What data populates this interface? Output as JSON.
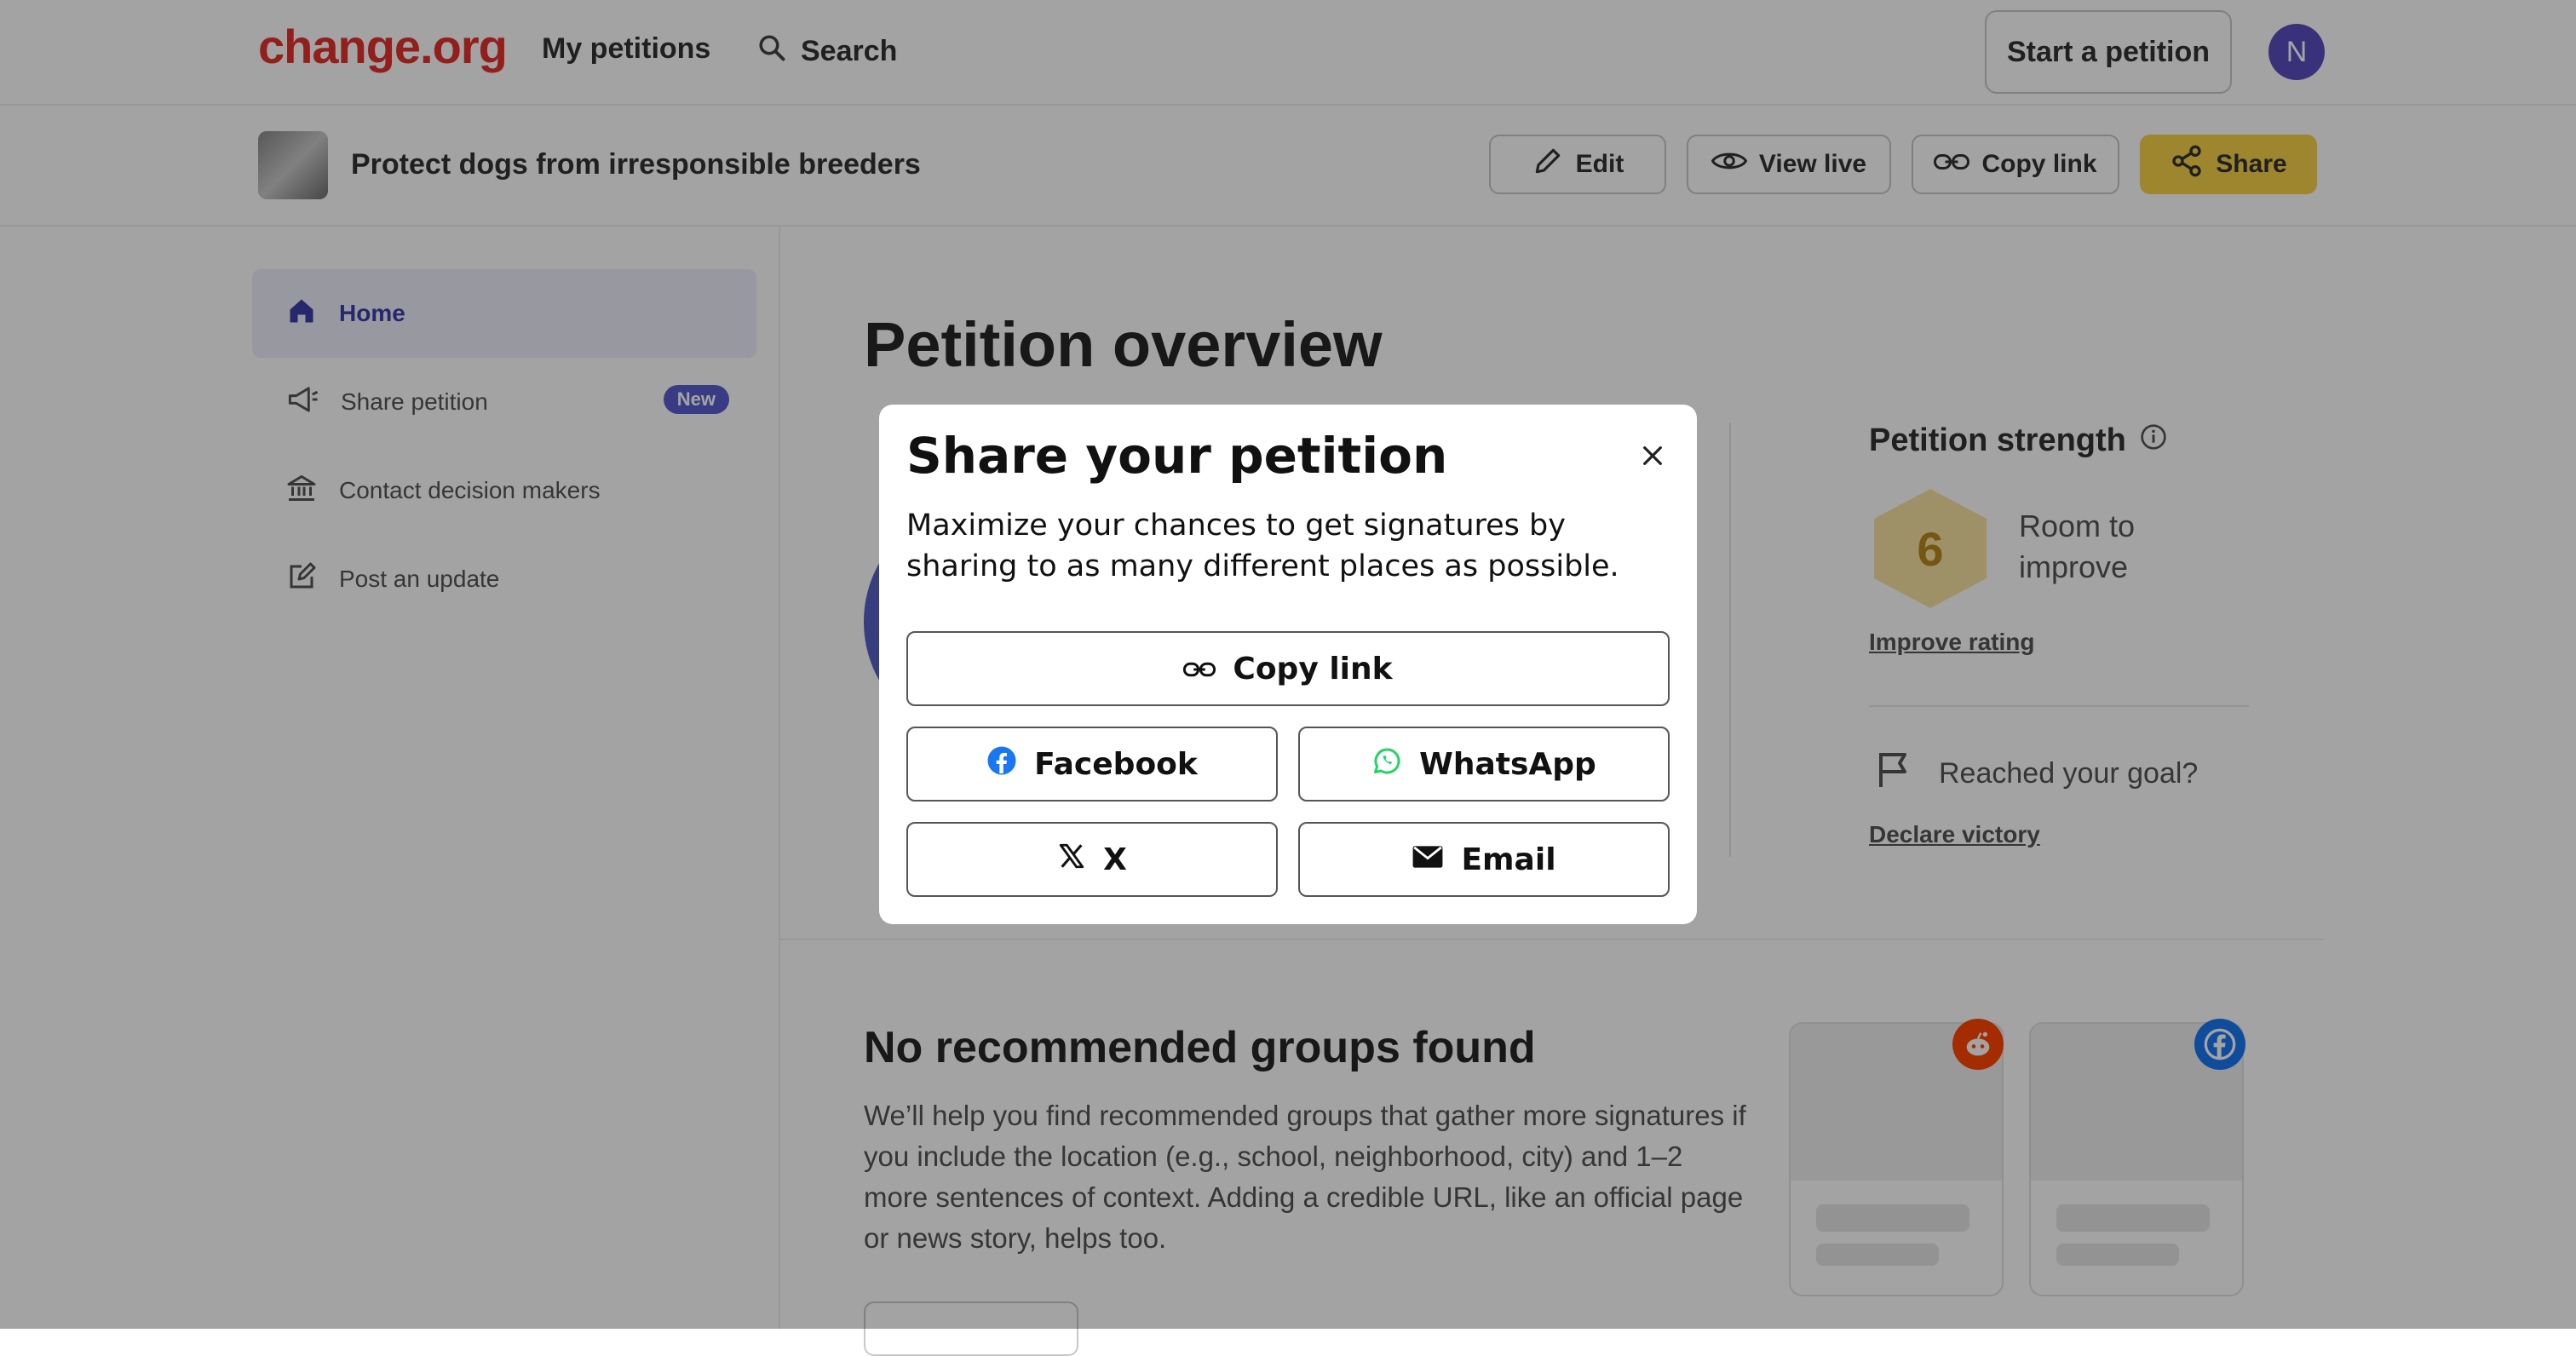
{
  "nav": {
    "logo": "change.org",
    "my_petitions": "My petitions",
    "search": "Search",
    "start_petition": "Start a petition",
    "avatar_initial": "N"
  },
  "petition": {
    "title": "Protect dogs from irresponsible breeders",
    "buttons": {
      "edit": "Edit",
      "view_live": "View live",
      "copy_link": "Copy link",
      "share": "Share"
    }
  },
  "sidebar": {
    "items": [
      {
        "label": "Home",
        "icon": "home-icon",
        "active": true
      },
      {
        "label": "Share petition",
        "icon": "megaphone-icon",
        "badge": "New"
      },
      {
        "label": "Contact decision makers",
        "icon": "building-icon"
      },
      {
        "label": "Post an update",
        "icon": "edit-square-icon"
      }
    ]
  },
  "main": {
    "title": "Petition overview",
    "strength": {
      "title": "Petition strength",
      "score": "6",
      "rating_text": "Room to improve",
      "improve_link": "Improve rating"
    },
    "goal": {
      "text": "Reached your goal?",
      "link": "Declare victory"
    },
    "groups": {
      "title": "No recommended groups found",
      "text": "We’ll help you find recommended groups that gather more signatures if you include the location (e.g., school, neighborhood, city) and 1–2 more sentences of context. Adding a credible URL, like an official page or news story, helps too."
    }
  },
  "modal": {
    "title": "Share your petition",
    "description": "Maximize your chances to get signatures by sharing to as many different places as possible.",
    "buttons": {
      "copy_link": "Copy link",
      "facebook": "Facebook",
      "whatsapp": "WhatsApp",
      "x": "X",
      "email": "Email"
    }
  },
  "colors": {
    "brand": "#e4312b",
    "share_yellow": "#f8d24a",
    "accent_purple": "#5a5fd0",
    "facebook": "#1877f2",
    "whatsapp": "#25d366",
    "reddit": "#ff4500"
  }
}
